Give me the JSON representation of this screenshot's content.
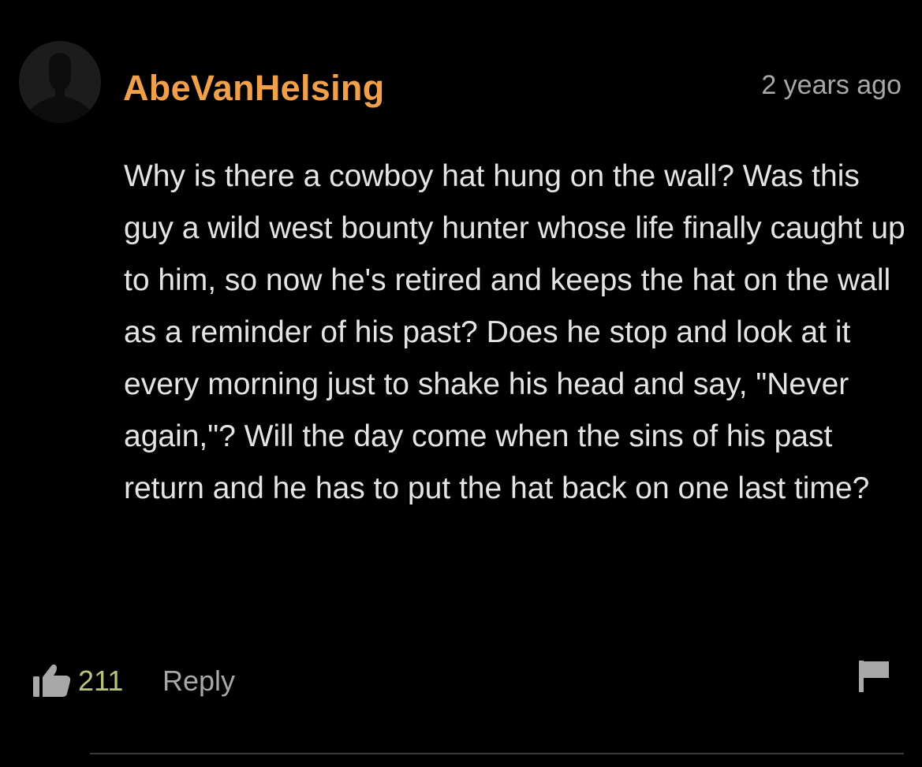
{
  "comment": {
    "author": "AbeVanHelsing",
    "timestamp": "2 years ago",
    "text": "Why is there a cowboy hat hung on the wall? Was this guy a wild west bounty hunter whose life finally caught up to him, so now he's retired and keeps the hat on the wall as a reminder of his past? Does he stop and look at it every morning just to shake his head and say, \"Never again,\"? Will the day come when the sins of his past return and he has to put the hat back on one last time?",
    "likes": "211",
    "reply_label": "Reply"
  },
  "icons": {
    "avatar": "default-user-silhouette",
    "like": "thumbs-up-icon",
    "flag": "flag-icon"
  },
  "colors": {
    "background": "#000000",
    "author": "#f0a04a",
    "text": "#e4e4e4",
    "muted": "#a8a8a8",
    "likes": "#b9c47a"
  }
}
